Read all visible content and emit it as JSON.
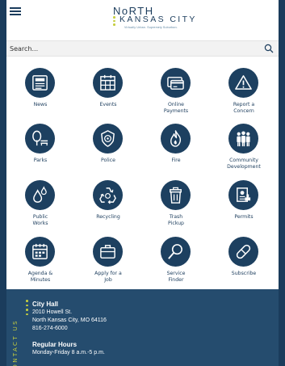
{
  "header": {
    "logo_line1": "NoRTH",
    "logo_line2": "KANSAS CITY",
    "logo_tagline": "Virtually Urban. Supremely Suburban."
  },
  "search": {
    "placeholder": "Search..."
  },
  "tiles": [
    {
      "label": "News",
      "icon": "newspaper-icon"
    },
    {
      "label": "Events",
      "icon": "calendar-grid-icon"
    },
    {
      "label": "Online\nPayments",
      "icon": "credit-card-icon"
    },
    {
      "label": "Report a\nConcern",
      "icon": "warning-icon"
    },
    {
      "label": "Parks",
      "icon": "tree-bench-icon"
    },
    {
      "label": "Police",
      "icon": "police-badge-icon"
    },
    {
      "label": "Fire",
      "icon": "flame-icon"
    },
    {
      "label": "Community\nDevelopment",
      "icon": "people-group-icon"
    },
    {
      "label": "Public\nWorks",
      "icon": "water-drops-icon"
    },
    {
      "label": "Recycling",
      "icon": "recycle-icon"
    },
    {
      "label": "Trash\nPickup",
      "icon": "trash-can-icon"
    },
    {
      "label": "Permits",
      "icon": "permit-document-icon"
    },
    {
      "label": "Agenda &\nMinutes",
      "icon": "agenda-calendar-icon"
    },
    {
      "label": "Apply for a\nJob",
      "icon": "briefcase-icon"
    },
    {
      "label": "Service\nFinder",
      "icon": "magnifier-icon"
    },
    {
      "label": "Subscribe",
      "icon": "pill-icon"
    }
  ],
  "footer": {
    "vertical_label": "CONTACT US",
    "city_hall_title": "City Hall",
    "address1": "2010 Howell St.",
    "address2": "North Kansas City, MO 64116",
    "phone": "816-274-6000",
    "hours_title": "Regular Hours",
    "hours": "Monday-Friday 8 a.m.-5 p.m."
  },
  "colors": {
    "navy": "#1d4060",
    "accent": "#c5cd3f",
    "footer_bg": "#254c6e"
  }
}
